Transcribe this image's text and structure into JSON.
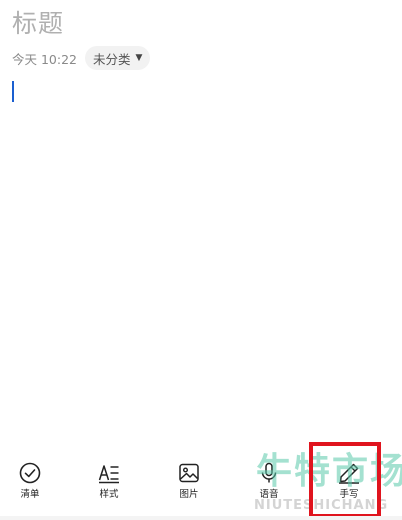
{
  "note": {
    "title": "标题",
    "time": "今天 10:22",
    "category": "未分类"
  },
  "toolbar": {
    "items": [
      {
        "label": "清单",
        "icon": "checklist-icon"
      },
      {
        "label": "样式",
        "icon": "text-style-icon"
      },
      {
        "label": "图片",
        "icon": "image-icon"
      },
      {
        "label": "语音",
        "icon": "microphone-icon"
      },
      {
        "label": "手写",
        "icon": "pen-icon"
      }
    ]
  },
  "watermark": {
    "chinese": "牛特市场",
    "english": "NIUTESHICHANG"
  },
  "colors": {
    "cursor": "#1a5fd0",
    "highlight": "#e0141e",
    "title_placeholder": "#b0b0b0"
  }
}
